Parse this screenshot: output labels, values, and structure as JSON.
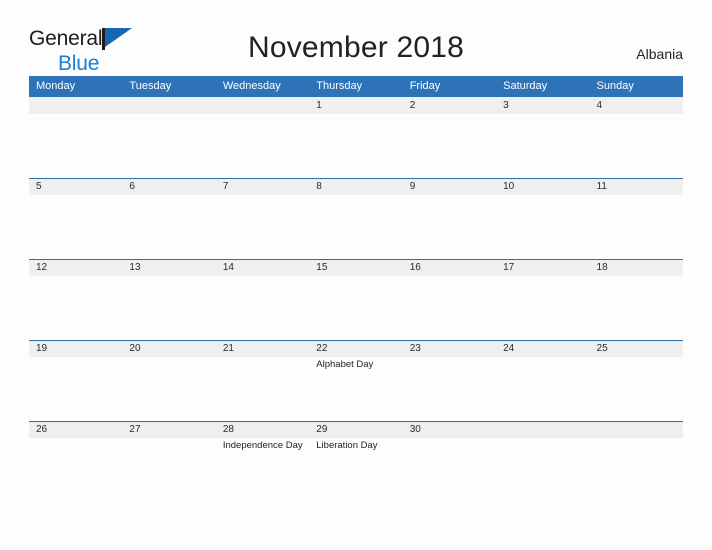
{
  "brand": {
    "name_part1": "General",
    "name_part2": "Blue",
    "flag_icon": "pennant-flag-icon"
  },
  "header": {
    "title": "November 2018",
    "region": "Albania"
  },
  "colors": {
    "header_blue": "#2e72b8",
    "divider_blue": "#2e6fa8",
    "band_gray": "#efefef",
    "brand_blue": "#1a7fd4",
    "page_background": "#fdfdfd",
    "text": "#222222"
  },
  "calendar": {
    "month": "November",
    "year": "2018",
    "weekday_headers": [
      "Monday",
      "Tuesday",
      "Wednesday",
      "Thursday",
      "Friday",
      "Saturday",
      "Sunday"
    ],
    "weeks": [
      [
        {
          "date": "",
          "event": ""
        },
        {
          "date": "",
          "event": ""
        },
        {
          "date": "",
          "event": ""
        },
        {
          "date": "1",
          "event": ""
        },
        {
          "date": "2",
          "event": ""
        },
        {
          "date": "3",
          "event": ""
        },
        {
          "date": "4",
          "event": ""
        }
      ],
      [
        {
          "date": "5",
          "event": ""
        },
        {
          "date": "6",
          "event": ""
        },
        {
          "date": "7",
          "event": ""
        },
        {
          "date": "8",
          "event": ""
        },
        {
          "date": "9",
          "event": ""
        },
        {
          "date": "10",
          "event": ""
        },
        {
          "date": "11",
          "event": ""
        }
      ],
      [
        {
          "date": "12",
          "event": ""
        },
        {
          "date": "13",
          "event": ""
        },
        {
          "date": "14",
          "event": ""
        },
        {
          "date": "15",
          "event": ""
        },
        {
          "date": "16",
          "event": ""
        },
        {
          "date": "17",
          "event": ""
        },
        {
          "date": "18",
          "event": ""
        }
      ],
      [
        {
          "date": "19",
          "event": ""
        },
        {
          "date": "20",
          "event": ""
        },
        {
          "date": "21",
          "event": ""
        },
        {
          "date": "22",
          "event": "Alphabet Day"
        },
        {
          "date": "23",
          "event": ""
        },
        {
          "date": "24",
          "event": ""
        },
        {
          "date": "25",
          "event": ""
        }
      ],
      [
        {
          "date": "26",
          "event": ""
        },
        {
          "date": "27",
          "event": ""
        },
        {
          "date": "28",
          "event": "Independence Day"
        },
        {
          "date": "29",
          "event": "Liberation Day"
        },
        {
          "date": "30",
          "event": ""
        },
        {
          "date": "",
          "event": ""
        },
        {
          "date": "",
          "event": ""
        }
      ]
    ]
  }
}
